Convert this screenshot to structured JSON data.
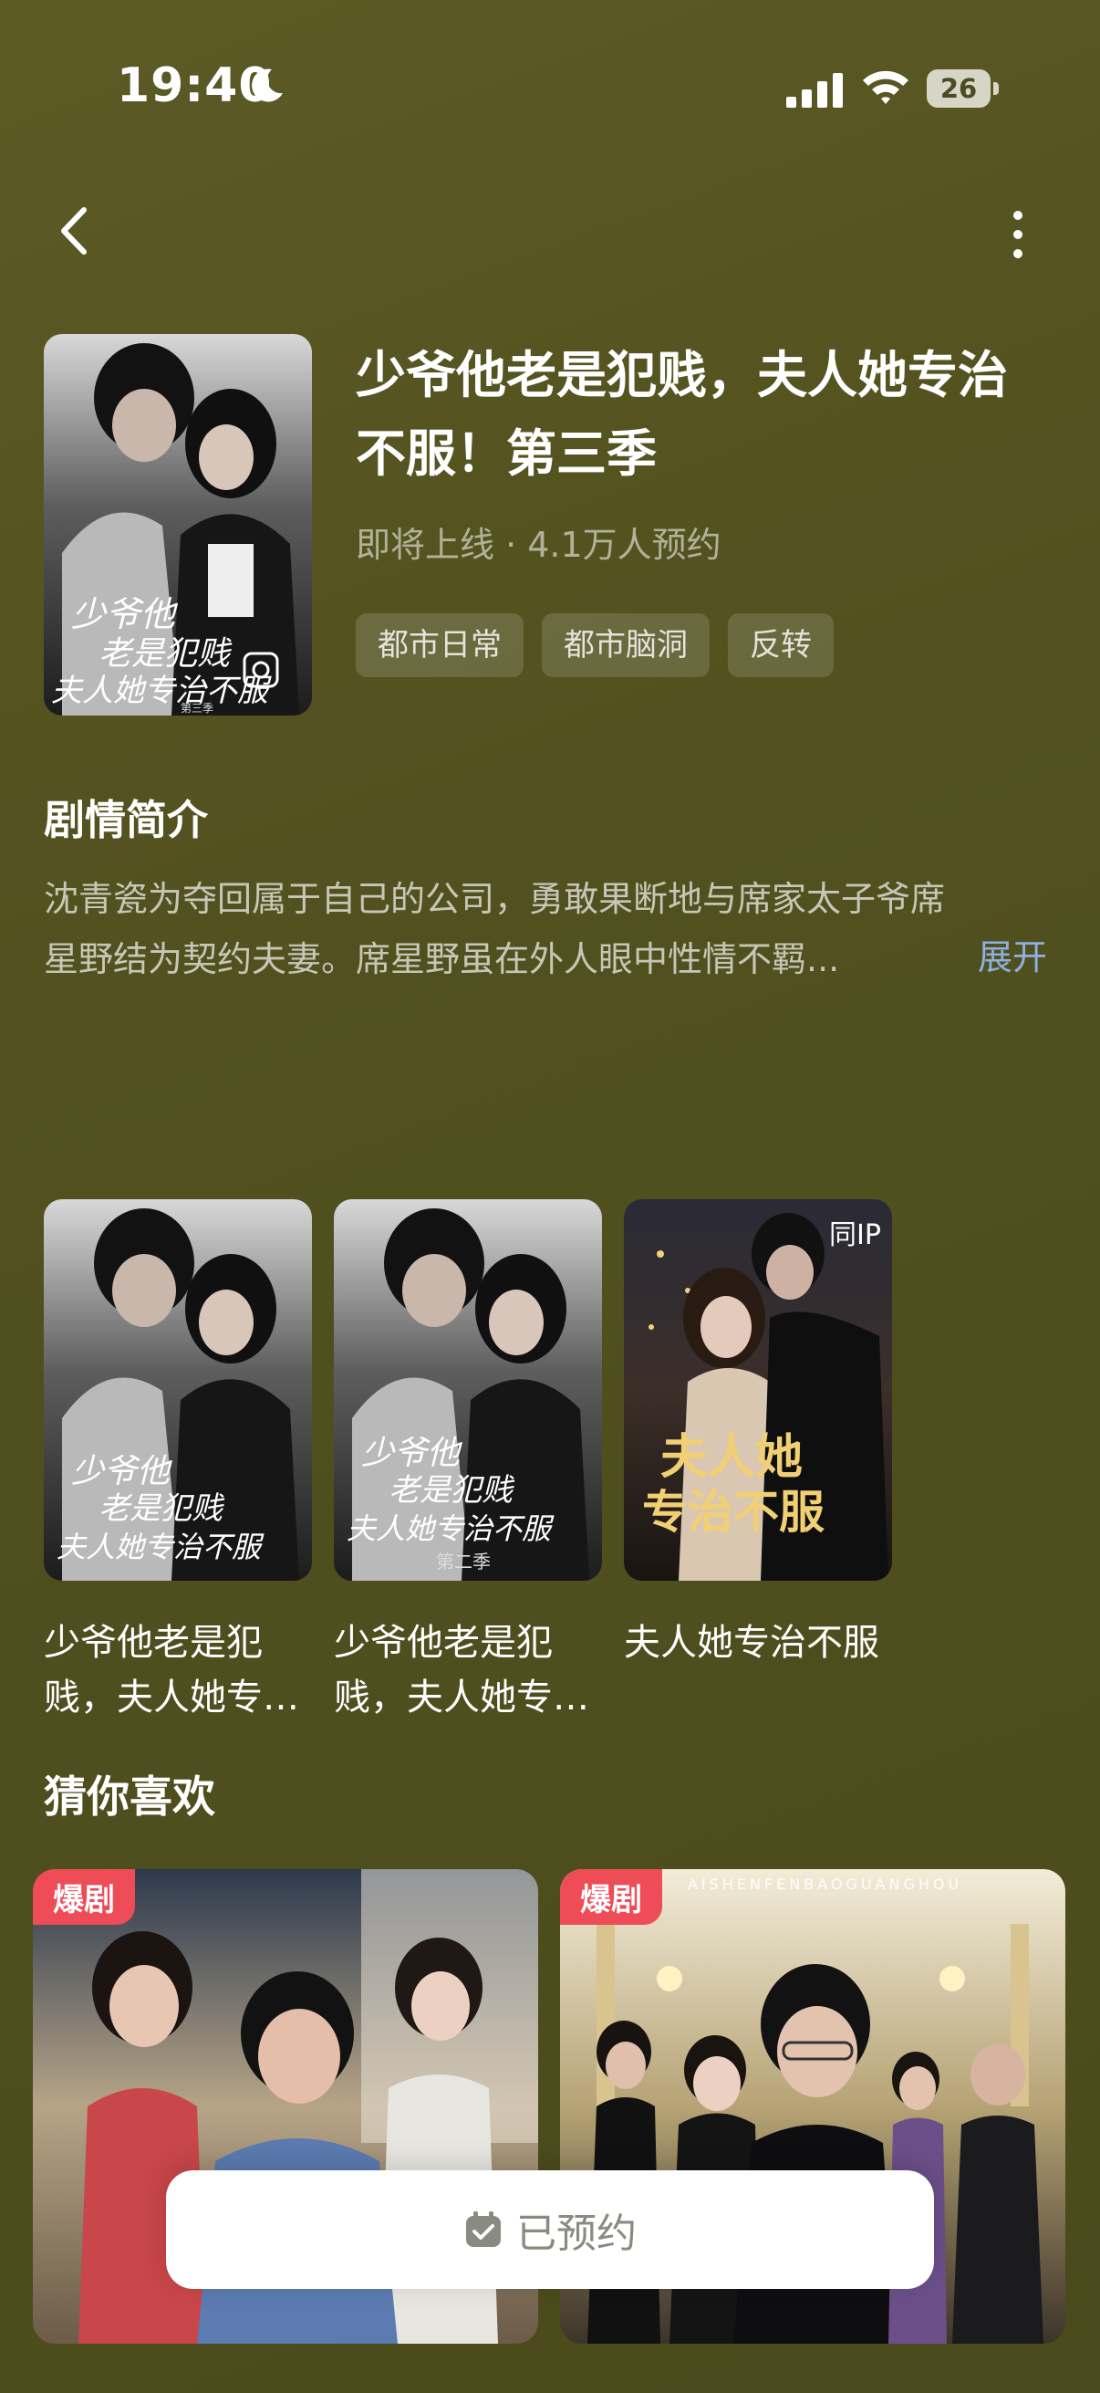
{
  "status_bar": {
    "time": "19:40",
    "battery": "26"
  },
  "show": {
    "title": "少爷他老是犯贱，夫人她专治不服！第三季",
    "status_line": "即将上线 · 4.1万人预约",
    "tags": [
      "都市日常",
      "都市脑洞",
      "反转"
    ],
    "cover_text": {
      "line1": "少爷他",
      "line2": "老是犯贱",
      "line3": "夫人她专治不服",
      "season": "第三季"
    }
  },
  "synopsis": {
    "heading": "剧情简介",
    "line1": "沈青瓷为夺回属于自己的公司，勇敢果断地与席家太子爷席",
    "line2": "星野结为契约夫妻。席星野虽在外人眼中性情不羁...",
    "expand_label": "展开"
  },
  "related": [
    {
      "line1": "少爷他老是犯",
      "line2": "贱，夫人她专…",
      "cover_line1": "少爷他",
      "cover_line2": "老是犯贱",
      "cover_line3": "夫人她专治不服"
    },
    {
      "line1": "少爷他老是犯",
      "line2": "贱，夫人她专…",
      "cover_line1": "少爷他",
      "cover_line2": "老是犯贱",
      "cover_line3": "夫人她专治不服",
      "season": "第二季"
    },
    {
      "line1": "夫人她专治不服",
      "line2": "",
      "badge": "同IP",
      "cover_line1": "夫人她",
      "cover_line2": "专治不服"
    }
  ],
  "guess": {
    "heading": "猜你喜欢",
    "cards": [
      {
        "badge": "爆剧"
      },
      {
        "badge": "爆剧",
        "top_text": "AISHENFENBAOGUANGHOU"
      }
    ]
  },
  "bottom": {
    "reserve_label": "已预约"
  },
  "colors": {
    "background": "#52511f",
    "hot_badge": "#ee4c56",
    "expand": "#8fb0e0"
  }
}
